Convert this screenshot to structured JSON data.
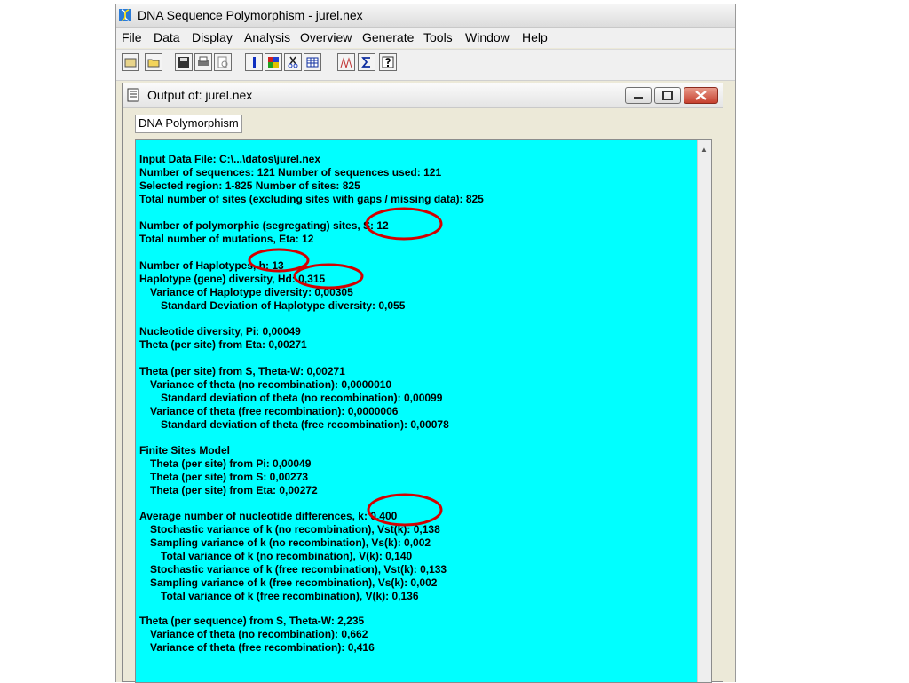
{
  "window": {
    "title": "DNA Sequence Polymorphism - jurel.nex"
  },
  "menu": [
    {
      "label": "File"
    },
    {
      "label": "Data"
    },
    {
      "label": "Display"
    },
    {
      "label": "Analysis"
    },
    {
      "label": "Overview"
    },
    {
      "label": "Generate"
    },
    {
      "label": "Tools"
    },
    {
      "label": "Window"
    },
    {
      "label": "Help"
    }
  ],
  "toolbar": {
    "buttons": [
      "open-icon",
      "folder-icon",
      "save-icon",
      "print-icon",
      "print-preview-icon",
      "info-icon",
      "color-grid-icon",
      "cut-icon",
      "table-icon",
      "graph-icon",
      "sigma-icon",
      "help-icon"
    ]
  },
  "child_window": {
    "title": "Output of: jurel.nex",
    "tab_label": "DNA Polymorphism"
  },
  "output": {
    "lines": [
      "Input Data File: C:\\...\\datos\\jurel.nex",
      "Number of sequences: 121    Number of sequences used: 121",
      "Selected region: 1-825   Number of sites: 825",
      "Total number of sites (excluding sites with gaps / missing data): 825",
      "Number of polymorphic (segregating) sites, S: 12",
      "Total number of mutations, Eta: 12",
      "Number of Haplotypes, h: 13",
      "Haplotype (gene) diversity, Hd: 0,315",
      "  Variance of Haplotype diversity: 0,00305",
      "    Standard Deviation of Haplotype diversity: 0,055",
      "Nucleotide diversity, Pi: 0,00049",
      "Theta (per site) from Eta: 0,00271",
      "Theta (per site) from S, Theta-W: 0,00271",
      "  Variance of theta (no recombination): 0,0000010",
      "    Standard deviation of theta (no recombination): 0,00099",
      "  Variance of theta (free recombination): 0,0000006",
      "    Standard deviation of theta (free recombination): 0,00078",
      "Finite Sites Model",
      "  Theta (per site) from Pi: 0,00049",
      "  Theta (per site) from S: 0,00273",
      "  Theta (per site) from Eta: 0,00272",
      "Average number of nucleotide differences, k: 0,400",
      "  Stochastic variance of k (no recombination), Vst(k): 0,138",
      "  Sampling variance of k (no recombination), Vs(k): 0,002",
      "    Total variance of k (no recombination), V(k): 0,140",
      "  Stochastic variance of k (free recombination), Vst(k): 0,133",
      "  Sampling variance of k (free recombination), Vs(k): 0,002",
      "    Total variance of k (free recombination), V(k): 0,136",
      "Theta (per sequence) from S, Theta-W: 2,235",
      "  Variance of theta (no recombination): 0,662",
      "  Variance of theta (free recombination): 0,416"
    ]
  },
  "colors": {
    "output_background": "#00ffff",
    "annotation": "#d40000"
  }
}
